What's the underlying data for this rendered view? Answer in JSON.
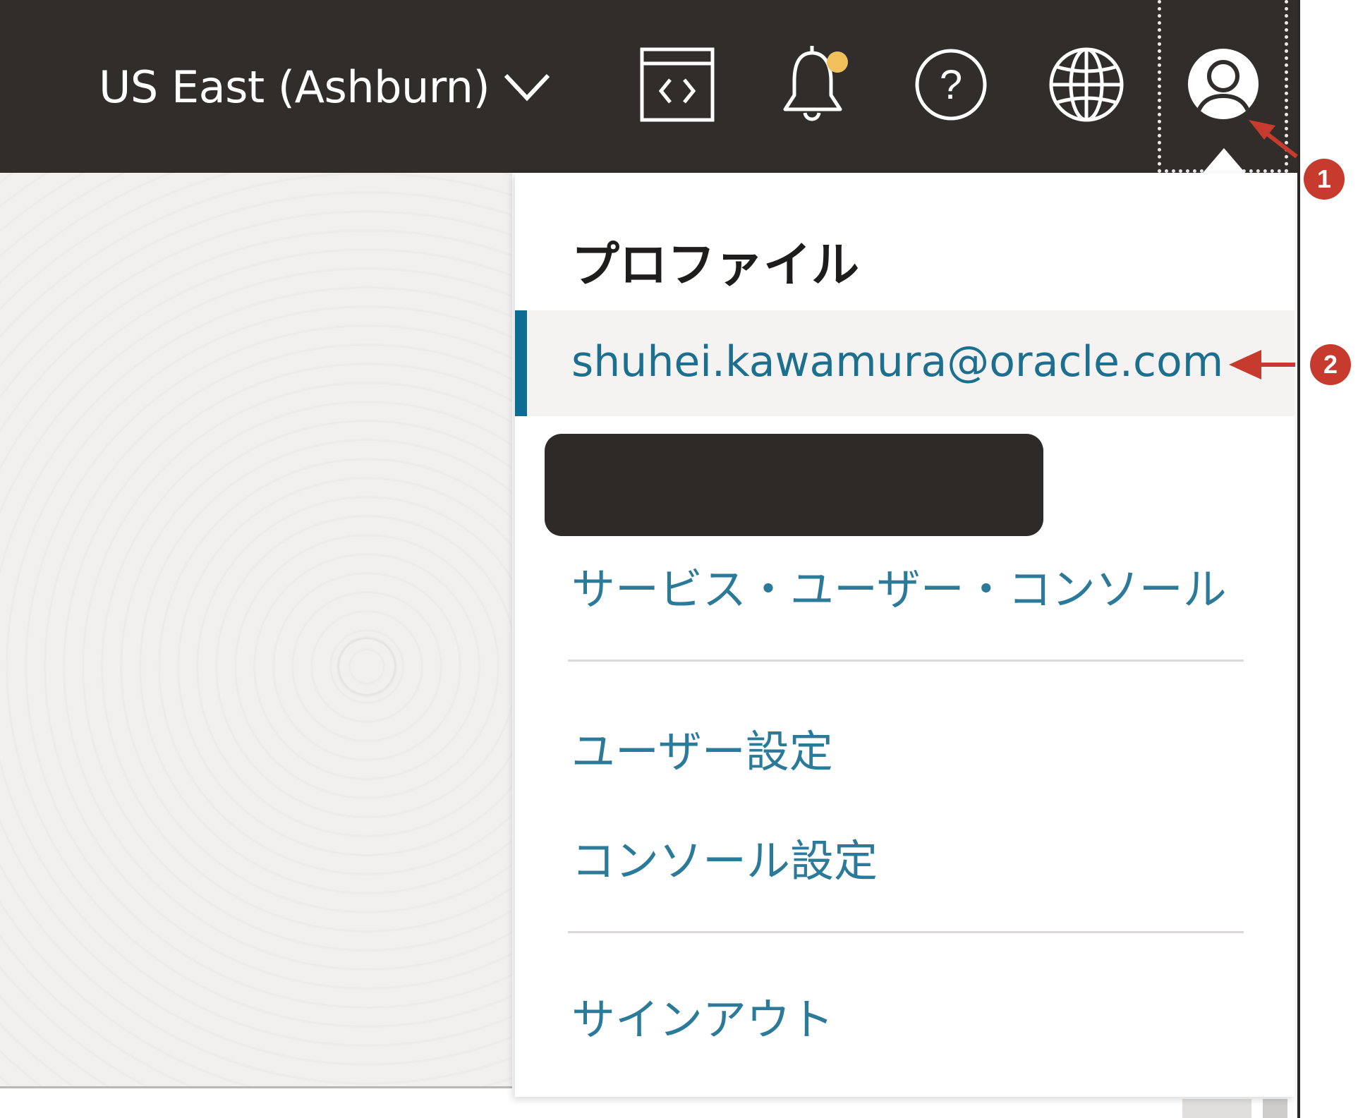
{
  "header": {
    "region_label": "US East (Ashburn)",
    "icons": [
      "code-editor-icon",
      "bell-icon",
      "help-icon",
      "globe-icon",
      "profile-avatar-icon"
    ],
    "notification_dot_color": "#f0c05a",
    "bg_color": "#312d2a"
  },
  "profile_menu": {
    "title": "プロファイル",
    "email": "shuhei.kawamura@oracle.com",
    "service_user_console": "サービス・ユーザー・コンソール",
    "user_settings": "ユーザー設定",
    "console_settings": "コンソール設定",
    "sign_out": "サインアウト",
    "accent_color": "#0c6c91",
    "link_color": "#2b7a99"
  },
  "annotations": {
    "badge_1": "1",
    "badge_2": "2",
    "color": "#c73a2e"
  }
}
